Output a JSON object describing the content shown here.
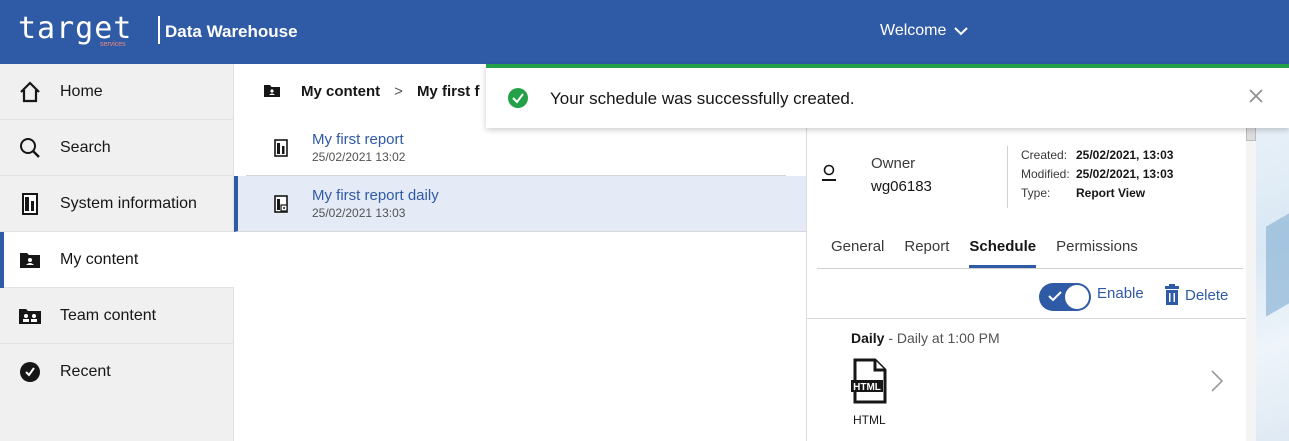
{
  "header": {
    "logo_text": "target",
    "logo_sub": "services",
    "app_title": "Data Warehouse",
    "welcome_label": "Welcome"
  },
  "sidebar": {
    "items": [
      {
        "label": "Home",
        "icon": "home-icon"
      },
      {
        "label": "Search",
        "icon": "search-icon"
      },
      {
        "label": "System information",
        "icon": "report-icon"
      },
      {
        "label": "My content",
        "icon": "folder-icon",
        "active": true
      },
      {
        "label": "Team content",
        "icon": "team-folder-icon"
      },
      {
        "label": "Recent",
        "icon": "clock-icon"
      }
    ]
  },
  "breadcrumb": {
    "first": "My content",
    "second": "My first f"
  },
  "list": {
    "items": [
      {
        "name": "My first report",
        "date": "25/02/2021 13:02"
      },
      {
        "name": "My first report daily",
        "date": "25/02/2021 13:03",
        "selected": true
      }
    ]
  },
  "toast": {
    "message": "Your schedule was successfully created."
  },
  "details": {
    "owner_label": "Owner",
    "owner_value": "wg06183",
    "created_label": "Created:",
    "created_value": "25/02/2021, 13:03",
    "modified_label": "Modified:",
    "modified_value": "25/02/2021, 13:03",
    "type_label": "Type:",
    "type_value": "Report View"
  },
  "tabs": [
    "General",
    "Report",
    "Schedule",
    "Permissions"
  ],
  "active_tab": "Schedule",
  "schedule": {
    "enable_label": "Enable",
    "delete_label": "Delete",
    "frequency": "Daily",
    "description": " - Daily at 1:00 PM",
    "format_icon_text": "HTML",
    "format_label": "HTML"
  },
  "colors": {
    "brand": "#2f5aa6",
    "success": "#24a148"
  }
}
